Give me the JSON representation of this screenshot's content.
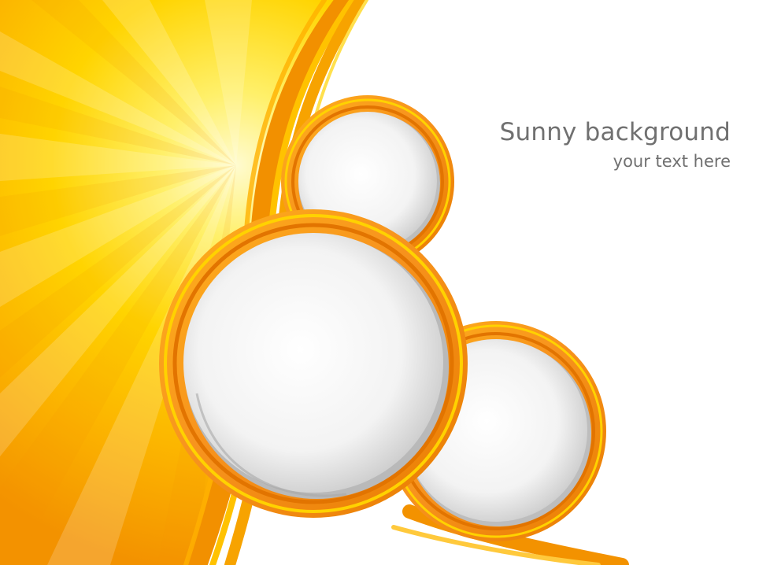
{
  "text": {
    "title": "Sunny background",
    "subtitle": "your text here"
  },
  "colors": {
    "sun_light": "#fffbd0",
    "sun_yellow": "#ffd400",
    "sun_orange": "#f9a000",
    "deep_orange": "#f07c00",
    "ring_orange": "#f7931e",
    "ring_yellow": "#ffd200",
    "disc_light": "#ffffff",
    "disc_shadow": "#cfcfcf",
    "text_gray": "#707070",
    "background": "#ffffff"
  },
  "decor": {
    "style": "sun burst with swooping orange ribbons and three framed circles"
  }
}
